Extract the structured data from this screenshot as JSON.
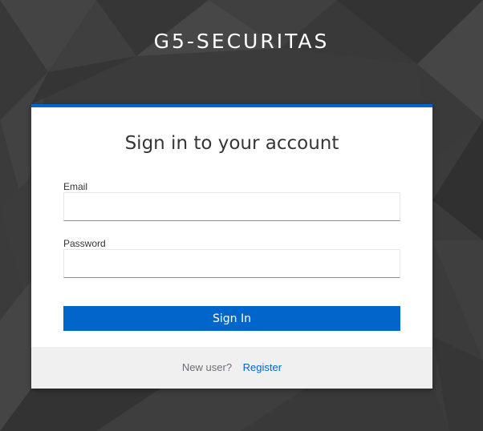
{
  "brand": {
    "title": "G5-SECURITAS"
  },
  "login": {
    "heading": "Sign in to your account",
    "email_label": "Email",
    "email_value": "",
    "password_label": "Password",
    "password_value": "",
    "submit_label": "Sign In"
  },
  "footer": {
    "new_user_text": "New user?",
    "register_label": "Register"
  },
  "colors": {
    "accent": "#0066cc",
    "background": "#3a3a3a",
    "footer_bg": "#f0f0f0"
  }
}
